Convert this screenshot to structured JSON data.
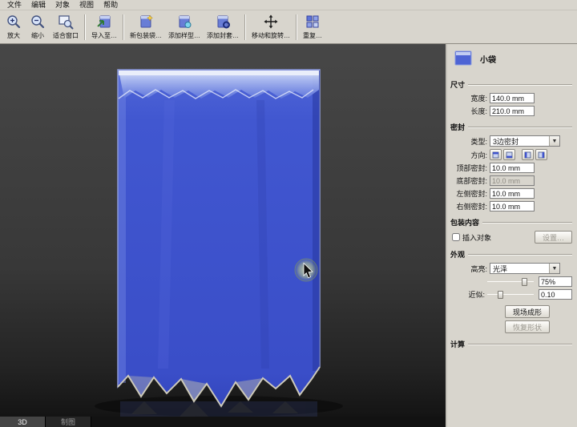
{
  "menu": {
    "items": [
      "文件",
      "编辑",
      "对象",
      "视图",
      "帮助"
    ]
  },
  "toolbar": {
    "buttons": [
      {
        "name": "zoom-in",
        "label": "放大"
      },
      {
        "name": "zoom-out",
        "label": "缩小"
      },
      {
        "name": "fit-window",
        "label": "适合窗口"
      },
      {
        "name": "import-to",
        "label": "导入至…"
      },
      {
        "name": "new-bag",
        "label": "新包装袋…"
      },
      {
        "name": "add-pattern",
        "label": "添加样型…"
      },
      {
        "name": "add-sleeve",
        "label": "添加封套…"
      },
      {
        "name": "move-rotate",
        "label": "移动和旋转…"
      },
      {
        "name": "repeat",
        "label": "重复…"
      }
    ]
  },
  "panel": {
    "title": "小袋",
    "dimensions": {
      "header": "尺寸",
      "width_label": "宽度:",
      "width_value": "140.0 mm",
      "length_label": "长度:",
      "length_value": "210.0 mm"
    },
    "seal": {
      "header": "密封",
      "type_label": "类型:",
      "type_value": "3边密封",
      "direction_label": "方向:",
      "top_label": "顶部密封:",
      "top_value": "10.0 mm",
      "bottom_label": "底部密封:",
      "bottom_value": "10.0 mm",
      "bottom_disabled": true,
      "left_label": "左侧密封:",
      "left_value": "10.0 mm",
      "right_label": "右侧密封:",
      "right_value": "10.0 mm"
    },
    "content": {
      "header": "包装内容",
      "insert_label": "插入对象",
      "insert_checked": false,
      "settings_button": "设置…",
      "settings_disabled": true
    },
    "appearance": {
      "header": "外观",
      "highlight_label": "高亮:",
      "highlight_value": "光泽",
      "highlight_percent": "75%",
      "approx_label": "近似:",
      "approx_value": "0.10",
      "live_shape_button": "现场成形",
      "restore_button": "恢复形状",
      "restore_disabled": true
    },
    "compute": {
      "header": "计算"
    }
  },
  "tabs": {
    "tab_3d": "3D",
    "tab_drawing": "制图"
  },
  "colors": {
    "bag_blue": "#3f53cb",
    "bag_top_light": "#c2cdf2",
    "panel_bg": "#d8d5cd",
    "canvas_dark": "#2e2e2e",
    "cursor_glow": "#dce89a"
  }
}
